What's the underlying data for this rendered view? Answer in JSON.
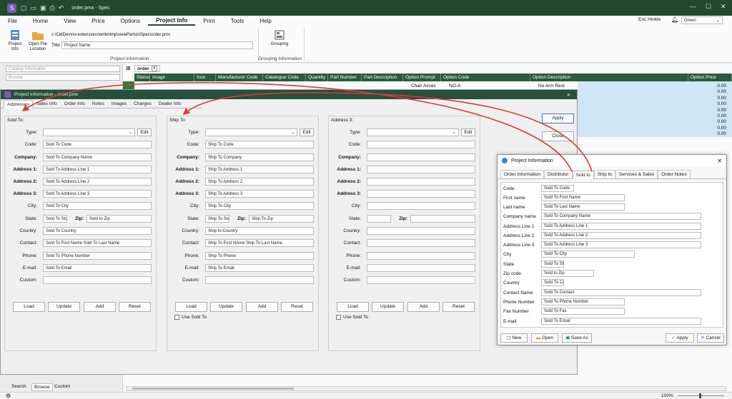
{
  "app": {
    "title": "order.pmx - Spec",
    "user": "Eric Hinkle",
    "theme_value": "Green",
    "logo_glyph": "S"
  },
  "menu": [
    "File",
    "Home",
    "View",
    "Price",
    "Options",
    "Project Info",
    "Print",
    "Tools",
    "Help"
  ],
  "ribbon": {
    "project_info_label": "Project Info",
    "open_file_location_label": "Open File Location",
    "path": "c:\\CetDev\\no-extensions\\write\\tmp\\viewPartsInSpec\\order.pmx",
    "title_label": "Title",
    "title_placeholder": "Project Name",
    "grouping_label": "Grouping",
    "group_project_info": "Project Information",
    "group_grouping_info": "Grouping Information"
  },
  "left_panel": {
    "catalog_placeholder": "Catalog Information",
    "browse_placeholder": "Browse",
    "tabs": [
      "Search",
      "Browse",
      "Custom"
    ]
  },
  "grid": {
    "tab_label": "order",
    "columns": [
      "Status",
      "Image",
      "Icon",
      "Manufacturer Code",
      "Catalogue Code",
      "Quantity",
      "Part Number",
      "Part Description",
      "Option Prompt",
      "Option Code",
      "Option Description",
      "Option Price"
    ],
    "first_row": {
      "prompt": "Chair Acces",
      "code": "NO-A",
      "description": "No Arm Rest"
    },
    "prices": [
      "0.00",
      "0.00",
      "0.00",
      "0.00",
      "0.00",
      "0.00",
      "0.00",
      "0.00",
      "0.00"
    ]
  },
  "dialog1": {
    "title": "Project Information - order.pmx",
    "tabs": [
      "Addresses",
      "Sales Info",
      "Order Info",
      "Notes",
      "Images",
      "Charges",
      "Dealer Info"
    ],
    "apply_label": "Apply",
    "close_label": "Close",
    "edit_label": "Edit",
    "buttons": [
      "Load",
      "Update",
      "Add",
      "Reset"
    ],
    "use_sold_to_label": "Use Sold To",
    "field_labels": {
      "type": "Type:",
      "code": "Code:",
      "company": "Company:",
      "address1": "Address 1:",
      "address2": "Address 2:",
      "address3": "Address 3:",
      "city": "City:",
      "state": "State:",
      "zip": "Zip:",
      "country": "Country:",
      "contact": "Contact:",
      "phone": "Phone:",
      "email": "E-mail:",
      "custom": "Custom:"
    },
    "sold_to": {
      "legend": "Sold To:",
      "code": "Sold To Code",
      "company": "Sold To Company Name",
      "address1": "Sold To Address Line 1",
      "address2": "Sold To Address Line 2",
      "address3": "Sold To Address Line 3",
      "city": "Sold To City",
      "state": "Sold To Sta",
      "zip": "Sold to Zip",
      "country": "Sold To Country",
      "contact": "Sold To First Name Sold To Last Name",
      "phone": "Sold To Phone Number",
      "email": "Sold To Email",
      "custom": ""
    },
    "ship_to": {
      "legend": "Ship To:",
      "code": "Ship To Code",
      "company": "Ship To Company",
      "address1": "Ship To Address 1",
      "address2": "Ship To Address 2",
      "address3": "Ship To Address 3",
      "city": "Ship To City",
      "state": "Ship To Sta",
      "zip": "Ship To Zip",
      "country": "Ship to Country",
      "contact": "Ship To First NAme Ship To Last Name",
      "phone": "Ship To Phone",
      "email": "Ship To Email",
      "custom": ""
    },
    "address3": {
      "legend": "Address 3:",
      "code": "",
      "company": "",
      "address1": "",
      "address2": "",
      "address3": "",
      "city": "",
      "state": "",
      "zip": "",
      "country": "",
      "contact": "",
      "phone": "",
      "email": "",
      "custom": ""
    }
  },
  "dialog2": {
    "title": "Project Information",
    "tabs": [
      "Order Information",
      "Distributor",
      "Sold to",
      "Ship to",
      "Services & Sales",
      "Order Notes"
    ],
    "fields": [
      {
        "label": "Code",
        "value": "Sold To Code"
      },
      {
        "label": "First name",
        "value": "Sold To First Name"
      },
      {
        "label": "Last name",
        "value": "Sold To Last Name"
      },
      {
        "label": "Company name",
        "value": "Sold To Company Name"
      },
      {
        "label": "Address Line 1",
        "value": "Sold To Address Line 1"
      },
      {
        "label": "Address Line 2",
        "value": "Sold To Address Line 2"
      },
      {
        "label": "Address Line 3",
        "value": "Sold To Address Line 3"
      },
      {
        "label": "City",
        "value": "Sold To City"
      },
      {
        "label": "State",
        "value": "Sold To St"
      },
      {
        "label": "Zip code",
        "value": "Sold to Zip"
      },
      {
        "label": "Country",
        "value": "Sold To Cc"
      },
      {
        "label": "Contact Name",
        "value": "Sold To Contact"
      },
      {
        "label": "Phone Number",
        "value": "Sold To Phone Number"
      },
      {
        "label": "Fax Number",
        "value": "Sold To Fax"
      },
      {
        "label": "E-mail",
        "value": "Sold To Email"
      }
    ],
    "new_label": "New",
    "open_label": "Open",
    "save_as_label": "Save As",
    "apply_label": "Apply",
    "cancel_label": "Cancel"
  },
  "status": {
    "zoom": "100%"
  },
  "colors": {
    "accent": "#20492f",
    "arrow": "#d93a3a",
    "selection": "#cfe6f7"
  }
}
